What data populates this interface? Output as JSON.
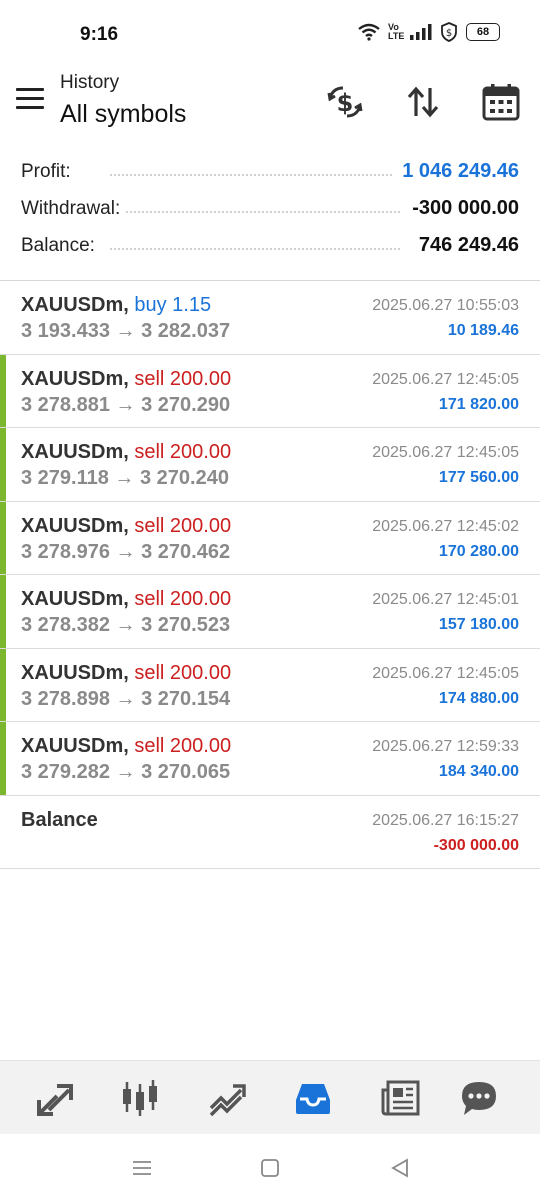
{
  "status": {
    "time": "9:16",
    "volte": "Vo LTE",
    "battery": "68"
  },
  "header": {
    "subtitle": "History",
    "title": "All symbols"
  },
  "summary": {
    "profit_label": "Profit:",
    "profit_value": "1 046 249.46",
    "withdrawal_label": "Withdrawal:",
    "withdrawal_value": "-300 000.00",
    "balance_label": "Balance:",
    "balance_value": "746 249.46"
  },
  "trades": [
    {
      "symbol": "XAUUSDm,",
      "type": "buy 1.15",
      "prices": "3 193.433 → 3 282.037",
      "time": "2025.06.27 10:55:03",
      "profit": "10 189.46"
    },
    {
      "symbol": "XAUUSDm,",
      "type": "sell 200.00",
      "prices": "3 278.881 → 3 270.290",
      "time": "2025.06.27 12:45:05",
      "profit": "171 820.00"
    },
    {
      "symbol": "XAUUSDm,",
      "type": "sell 200.00",
      "prices": "3 279.118 → 3 270.240",
      "time": "2025.06.27 12:45:05",
      "profit": "177 560.00"
    },
    {
      "symbol": "XAUUSDm,",
      "type": "sell 200.00",
      "prices": "3 278.976 → 3 270.462",
      "time": "2025.06.27 12:45:02",
      "profit": "170 280.00"
    },
    {
      "symbol": "XAUUSDm,",
      "type": "sell 200.00",
      "prices": "3 278.382 → 3 270.523",
      "time": "2025.06.27 12:45:01",
      "profit": "157 180.00"
    },
    {
      "symbol": "XAUUSDm,",
      "type": "sell 200.00",
      "prices": "3 278.898 → 3 270.154",
      "time": "2025.06.27 12:45:05",
      "profit": "174 880.00"
    },
    {
      "symbol": "XAUUSDm,",
      "type": "sell 200.00",
      "prices": "3 279.282 → 3 270.065",
      "time": "2025.06.27 12:59:33",
      "profit": "184 340.00"
    }
  ],
  "balance_entry": {
    "label": "Balance",
    "time": "2025.06.27 16:15:27",
    "amount": "-300 000.00"
  },
  "colors": {
    "accent_blue": "#1a73d9",
    "sell_red": "#cc1f1f",
    "bar_green": "#7cb82f"
  },
  "nav": {
    "items": [
      "quotes-icon",
      "chart-candles-icon",
      "trade-icon",
      "history-inbox-icon",
      "news-icon",
      "chat-icon"
    ],
    "active": "history-inbox-icon"
  }
}
